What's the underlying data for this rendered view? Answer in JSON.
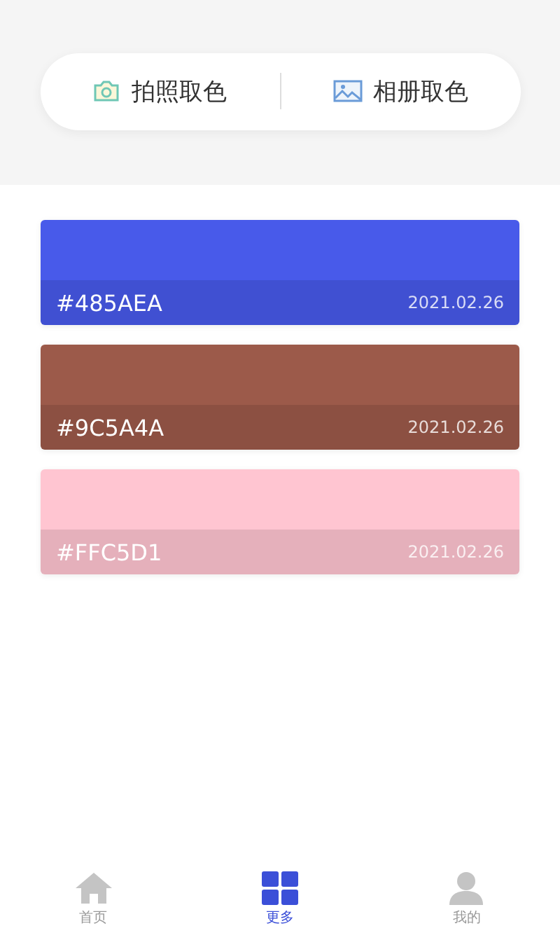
{
  "pick_bar": [
    {
      "kind": "camera",
      "label": "拍照取色"
    },
    {
      "kind": "album",
      "label": "相册取色"
    }
  ],
  "swatches": [
    {
      "color": "#485aea",
      "code": "#485AEA",
      "date": "2021.02.26"
    },
    {
      "color": "#9c5a4a",
      "code": "#9C5A4A",
      "date": "2021.02.26"
    },
    {
      "color": "#ffc5d1",
      "code": "#FFC5D1",
      "date": "2021.02.26"
    }
  ],
  "tab_bar": [
    {
      "kind": "home",
      "label": "首页",
      "selected": false
    },
    {
      "kind": "grid",
      "label": "更多",
      "selected": true
    },
    {
      "kind": "person",
      "label": "我的",
      "selected": false
    }
  ]
}
